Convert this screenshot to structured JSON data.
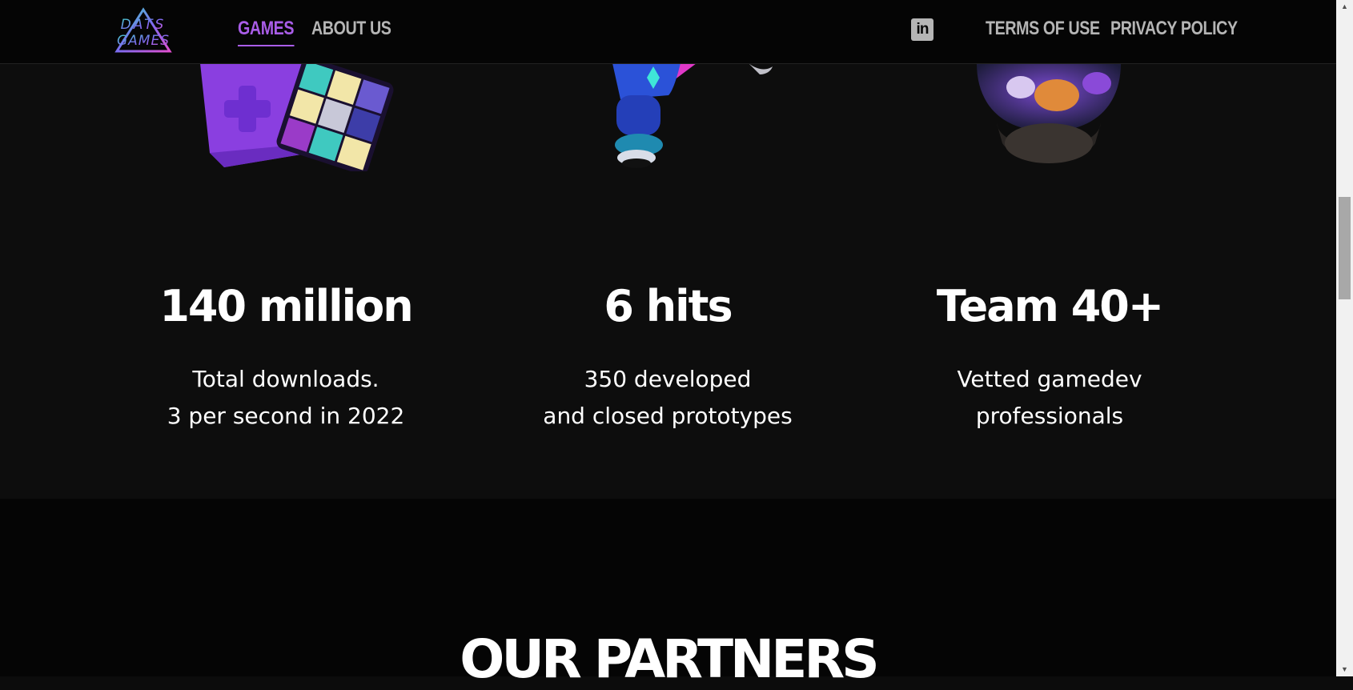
{
  "header": {
    "logo_text": "DATS GAMES",
    "nav": [
      {
        "label": "GAMES",
        "active": true
      },
      {
        "label": "ABOUT US",
        "active": false
      }
    ],
    "social_icon": "linkedin-icon",
    "social_label": "in",
    "links": [
      {
        "label": "TERMS OF USE"
      },
      {
        "label": "PRIVACY POLICY"
      }
    ]
  },
  "stats": [
    {
      "title": "140 million",
      "lines": [
        "Total downloads.",
        "3 per second in 2022"
      ],
      "image": "gamepad-and-cube-illustration"
    },
    {
      "title": "6 hits",
      "lines": [
        "350 developed",
        "and closed prototypes"
      ],
      "image": "robot-character-illustration"
    },
    {
      "title": "Team 40+",
      "lines": [
        "Vetted gamedev",
        "professionals"
      ],
      "image": "snow-globe-illustration"
    }
  ],
  "partners": {
    "title": "OUR PARTNERS"
  },
  "colors": {
    "accent": "#a95de8",
    "background": "#0d0d0d",
    "header_bg": "#050505",
    "nav_text": "#b5b5b5"
  }
}
